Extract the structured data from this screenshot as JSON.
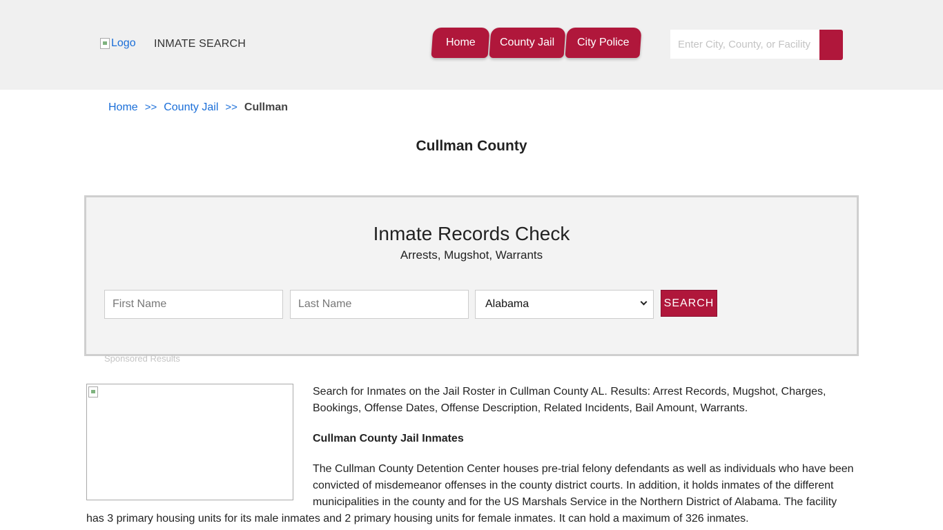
{
  "header": {
    "logo_alt": "Logo",
    "brand": "INMATE SEARCH",
    "nav": [
      "Home",
      "County Jail",
      "City Police"
    ],
    "search_placeholder": "Enter City, County, or Facility"
  },
  "breadcrumb": {
    "home": "Home",
    "sep": ">>",
    "section": "County Jail",
    "current": "Cullman"
  },
  "page_title": "Cullman County",
  "search_box": {
    "title": "Inmate Records Check",
    "subtitle": "Arrests, Mugshot, Warrants",
    "first_name_placeholder": "First Name",
    "last_name_placeholder": "Last Name",
    "state_selected": "Alabama",
    "button_label": "SEARCH",
    "sponsored": "Sponsored Results"
  },
  "content": {
    "intro": "Search for Inmates on the Jail Roster in Cullman County AL. Results: Arrest Records, Mugshot, Charges, Bookings, Offense Dates, Offense Description, Related Incidents, Bail Amount, Warrants.",
    "heading": "Cullman County Jail Inmates",
    "body_wrapped": "The Cullman County Detention Center houses pre-trial felony defendants as well as individuals who have been convicted of misdemeanor offenses in the county district courts. In addition, it holds inmates of the different municipalities in the county and for the US Marshals Service in the Northern District of Alabama. The facility",
    "body_full": "has 3 primary housing units for its male inmates and 2 primary housing units for female inmates. It can hold a maximum of 326 inmates."
  },
  "colors": {
    "accent": "#b0173b",
    "link": "#1a6ed8",
    "header_bg": "#f0f0f0"
  }
}
